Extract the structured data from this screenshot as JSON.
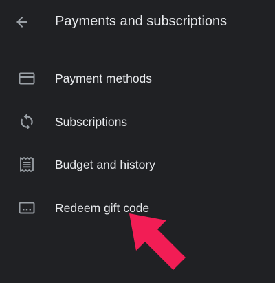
{
  "header": {
    "title": "Payments and subscriptions",
    "back_icon": "arrow-back-icon"
  },
  "menu": {
    "items": [
      {
        "label": "Payment methods",
        "icon": "credit-card-icon"
      },
      {
        "label": "Subscriptions",
        "icon": "sync-icon"
      },
      {
        "label": "Budget and history",
        "icon": "receipt-icon"
      },
      {
        "label": "Redeem gift code",
        "icon": "gift-code-icon"
      }
    ]
  },
  "annotation": {
    "arrow_icon": "red-pointer-arrow-icon",
    "arrow_color": "#f21d55"
  },
  "colors": {
    "background": "#202124",
    "text": "#e8eaed",
    "icon": "#9aa0a6"
  }
}
